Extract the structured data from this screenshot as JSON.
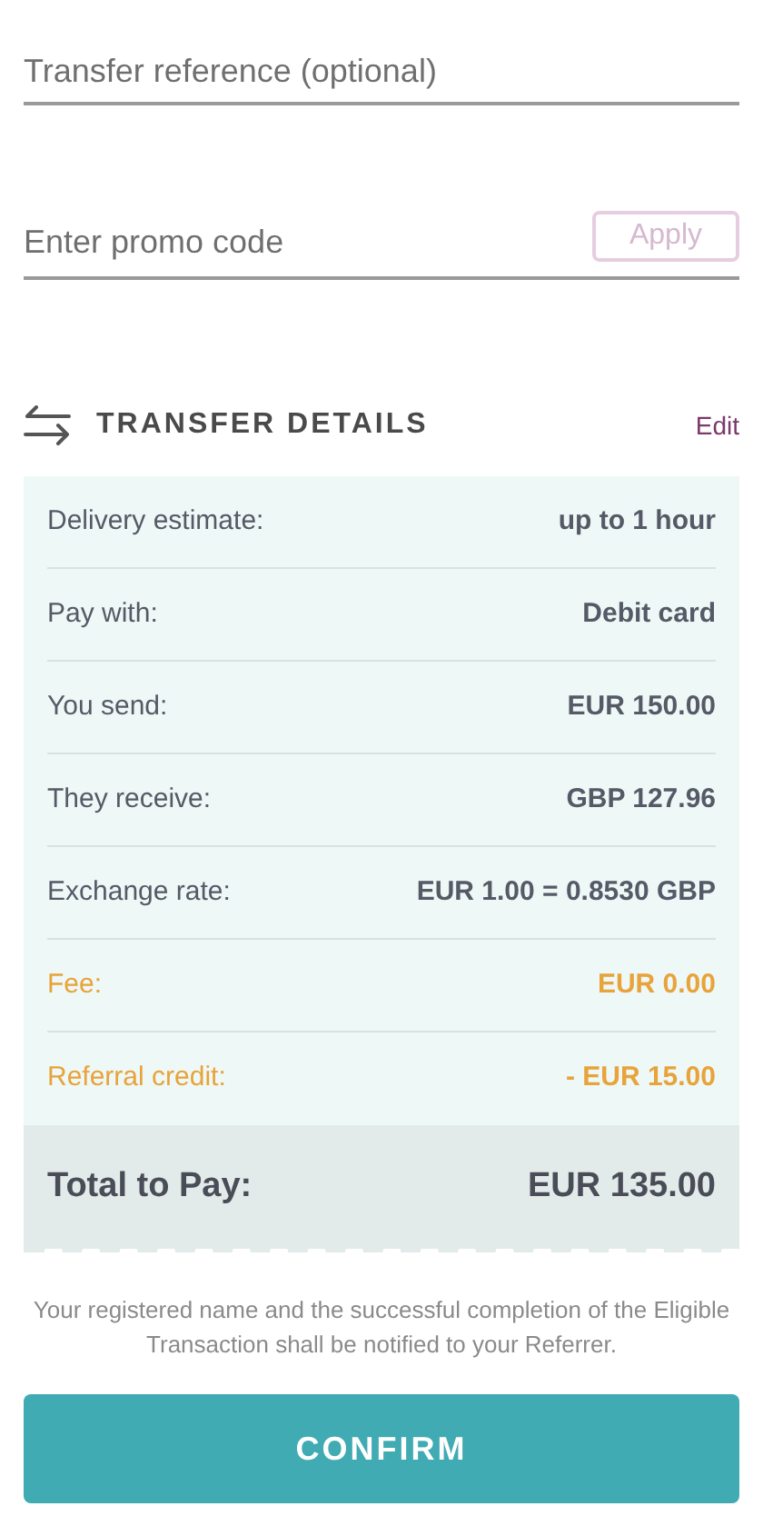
{
  "reference_field": {
    "placeholder": "Transfer reference (optional)"
  },
  "promo": {
    "placeholder": "Enter promo code",
    "apply_label": "Apply"
  },
  "section": {
    "title": "TRANSFER DETAILS",
    "edit_label": "Edit"
  },
  "rows": [
    {
      "label": "Delivery estimate:",
      "value": "up to 1 hour",
      "kind": "normal"
    },
    {
      "label": "Pay with:",
      "value": "Debit card",
      "kind": "normal"
    },
    {
      "label": "You send:",
      "value": "EUR 150.00",
      "kind": "normal"
    },
    {
      "label": "They receive:",
      "value": "GBP 127.96",
      "kind": "normal"
    },
    {
      "label": "Exchange rate:",
      "value": "EUR 1.00 = 0.8530 GBP",
      "kind": "normal"
    },
    {
      "label": "Fee:",
      "value": "EUR 0.00",
      "kind": "highlight"
    },
    {
      "label": "Referral credit:",
      "value": "- EUR 15.00",
      "kind": "highlight"
    }
  ],
  "total": {
    "label": "Total to Pay:",
    "value": "EUR 135.00"
  },
  "notice": "Your registered name and the successful completion of the Eligible Transaction shall be notified to your Referrer.",
  "confirm_label": "CONFIRM"
}
